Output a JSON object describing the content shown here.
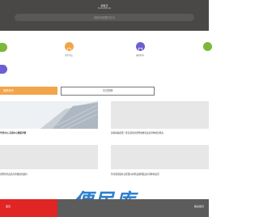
{
  "header": {
    "title": "模板天",
    "subtitle": "MUBANTIAN",
    "search_placeholder": "搜索你想要的资讯"
  },
  "icons": [
    {
      "name": "category-icon",
      "label": "",
      "color": "#7cb83a"
    },
    {
      "name": "forum-icon",
      "label": "留学论坛",
      "color": "#f2a44a"
    },
    {
      "name": "news-icon",
      "label": "最新新闻",
      "color": "#6b5fd1"
    },
    {
      "name": "more-icon",
      "label": "",
      "color": "#7cb83a"
    },
    {
      "name": "extra-icon",
      "label": "",
      "color": "#6b5fd1"
    }
  ],
  "tabs": {
    "recommend": "推荐资讯",
    "today": "今日热榜"
  },
  "cards": [
    {
      "title": "华府中心-东南中心精装详情"
    },
    {
      "title": "深圳两其配置一套安顿里北部墅电梯直改房间体验比例改"
    },
    {
      "title": "别墅住宅改造为新楼盘新品位"
    },
    {
      "title": "什的量花板各日配置好的里设施理装改房间体验改页"
    }
  ],
  "footer": {
    "left": "首页",
    "right": "联系我们"
  },
  "watermark": "便民库"
}
